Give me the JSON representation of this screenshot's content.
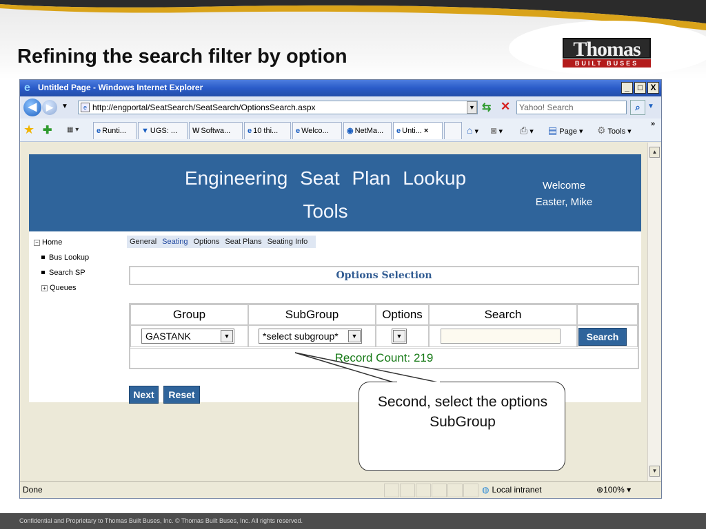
{
  "slide": {
    "title": "Refining the search filter by option",
    "logo_name": "Thomas",
    "logo_sub": "BUILT BUSES",
    "footer": "Confidential and Proprietary to Thomas Built Buses, Inc.  © Thomas Built Buses, Inc.  All rights reserved."
  },
  "window": {
    "title": "Untitled Page - Windows Internet Explorer",
    "minimize": "_",
    "maximize": "□",
    "close": "X"
  },
  "address": {
    "url": "http://engportal/SeatSearch/SeatSearch/OptionsSearch.aspx",
    "search_placeholder": "Yahoo! Search"
  },
  "tabs": [
    {
      "label": "Runti..."
    },
    {
      "label": "UGS: ..."
    },
    {
      "label": "Softwa..."
    },
    {
      "label": "10 thi..."
    },
    {
      "label": "Welco..."
    },
    {
      "label": "NetMa..."
    },
    {
      "label": "Unti..."
    }
  ],
  "commands": {
    "page": "Page",
    "tools": "Tools",
    "more": "»"
  },
  "banner": {
    "title": "Engineering  Seat  Plan  Lookup Tools",
    "welcome_line1": "Welcome",
    "welcome_line2": "Easter, Mike"
  },
  "tree": {
    "home": "Home",
    "bus_lookup": "Bus Lookup",
    "search_sp": "Search SP",
    "queues": "Queues"
  },
  "submenu": [
    "General",
    "Seating",
    "Options",
    "Seat Plans",
    "Seating Info"
  ],
  "options_title": "Options Selection",
  "grid": {
    "headers": [
      "Group",
      "SubGroup",
      "Options",
      "Search"
    ],
    "group_value": "GASTANK",
    "subgroup_value": "*select subgroup*",
    "options_value": "",
    "search_button": "Search",
    "record_count": "Record Count: 219"
  },
  "actions": {
    "next": "Next",
    "reset": "Reset"
  },
  "status": {
    "text": "Done",
    "zone": "Local intranet",
    "zoom": "100%"
  },
  "callout": {
    "text": "Second, select the options SubGroup"
  }
}
